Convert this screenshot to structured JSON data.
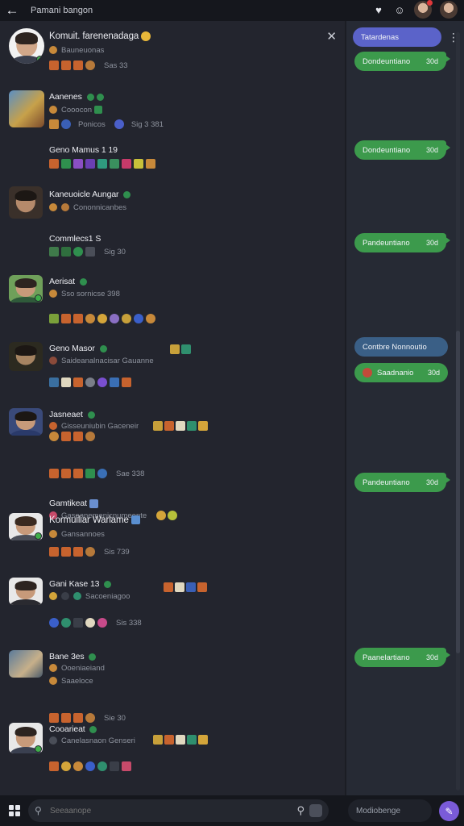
{
  "topbar": {
    "title": "Pamani bangon",
    "back_icon": "arrow-left-icon",
    "icons": [
      "heart-icon",
      "smiley-icon"
    ]
  },
  "panel": {
    "close_icon": "close-icon",
    "header": {
      "name": "Komuit. farenenadaga",
      "sub": "Bauneuonas",
      "meta": "Sas 33"
    }
  },
  "conversations": [
    {
      "name": "Aanenes",
      "sub": "Cooocon",
      "meta": "Ponicos",
      "meta2": "Sig 3 381"
    },
    {
      "name": "Geno Mamus 1 19",
      "sub": "",
      "meta": ""
    },
    {
      "name": "Kaneuoicle Aungar",
      "sub": "Cononnicanbes",
      "meta": ""
    },
    {
      "name": "Commlecs1 S",
      "sub": "",
      "meta": "Sig 30"
    },
    {
      "name": "Aerisat",
      "sub": "Sso sornicse 398",
      "meta": ""
    },
    {
      "name": "Geno Masor",
      "sub": "Saideanalnacisar Gauanne",
      "meta": ""
    },
    {
      "name": "Jasneaet",
      "sub": "Gisseuniubin Gaceneir",
      "meta": "Sae 338"
    },
    {
      "name": "Gamtikeat",
      "sub": "Gaseanemenicnumeonte",
      "meta": ""
    },
    {
      "name": "Kormuiliar Warlame",
      "sub": "Gansannoes",
      "meta": "Sis 739"
    },
    {
      "name": "Gani Kase 13",
      "sub": "Sacoeniagoo",
      "meta": "Sis 338"
    },
    {
      "name": "Bane 3es",
      "sub": "Ooeniaeiand",
      "sub2": "Saaeloce",
      "meta": "Sie 30"
    },
    {
      "name": "Cooarieat",
      "sub": "Canelasnaon Genseri",
      "meta": ""
    }
  ],
  "side": {
    "tab_label": "Tatardenas",
    "messages": [
      {
        "text": "Dondeuntiano",
        "time": "30d"
      },
      {
        "text": "Dondeuntiano",
        "time": "30d"
      },
      {
        "text": "Pandeuntiano",
        "time": "30d"
      },
      {
        "text": "Contbre Nonnoutio",
        "time": ""
      },
      {
        "text": "Saadnanio",
        "time": "30d"
      },
      {
        "text": "Pandeuntiano",
        "time": "30d"
      },
      {
        "text": "Paanelartiano",
        "time": "30d"
      }
    ]
  },
  "bottom": {
    "search_placeholder": "Seeaanope",
    "message_placeholder": "Modiobenge"
  },
  "colors": {
    "accent": "#5b63c9",
    "bubble": "#3c9a4c",
    "online": "#3fae4a",
    "send": "#7a5bd8"
  }
}
